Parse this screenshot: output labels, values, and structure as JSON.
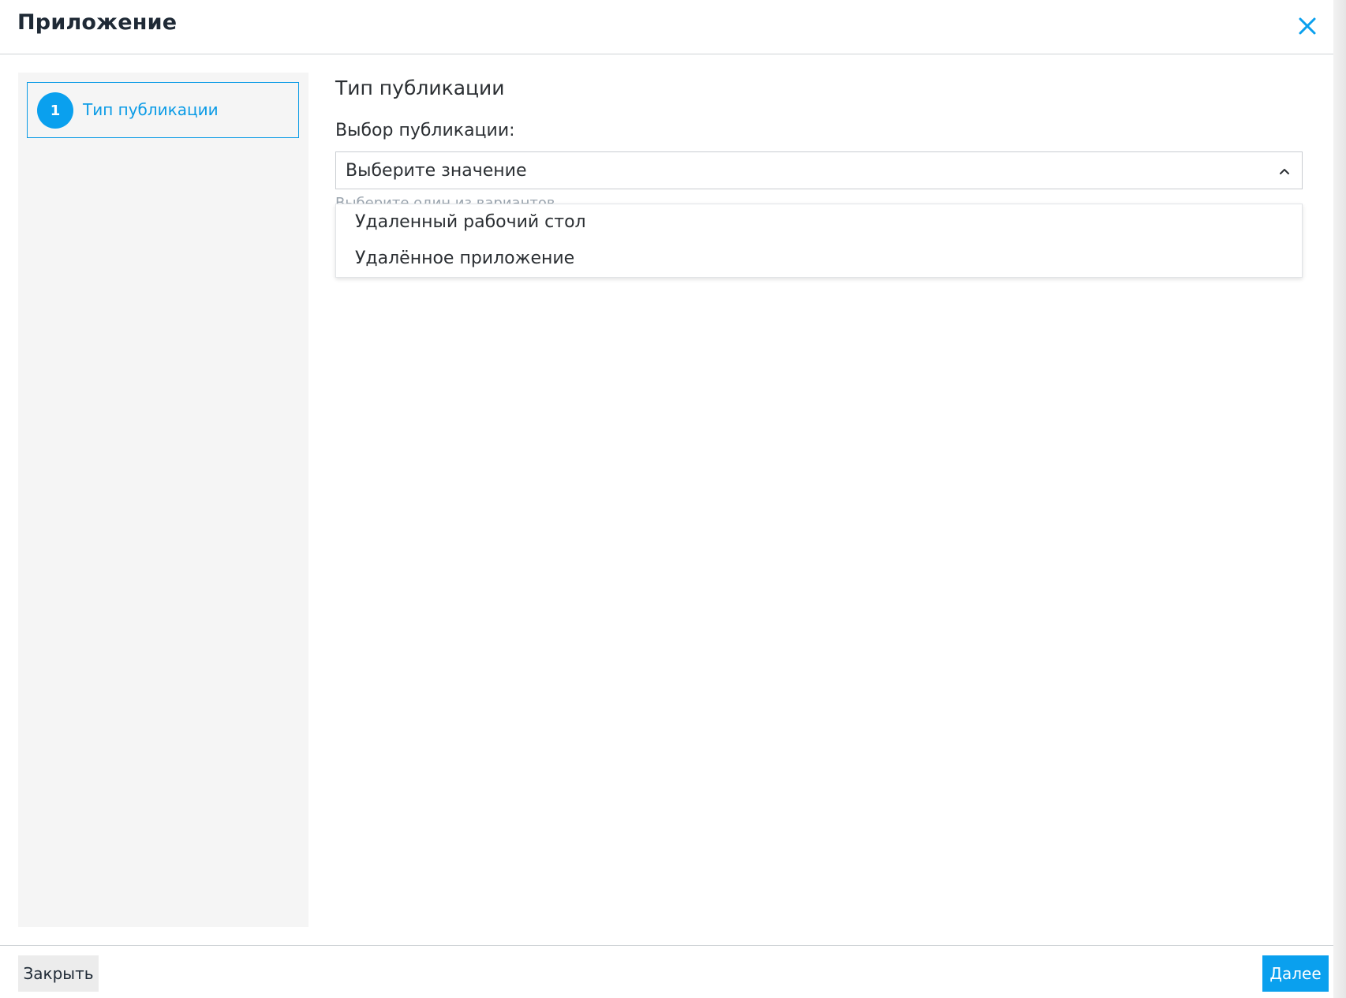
{
  "dialog": {
    "title": "Приложение",
    "close_icon": "close-icon"
  },
  "sidebar": {
    "steps": [
      {
        "number": "1",
        "label": "Тип публикации",
        "active": true
      }
    ]
  },
  "main": {
    "section_title": "Тип публикации",
    "field_label": "Выбор публикации:",
    "select": {
      "value": "Выберите значение",
      "expanded": true,
      "hint": "Выберите один из вариантов",
      "options": [
        "Удаленный рабочий стол",
        "Удалённое приложение"
      ]
    }
  },
  "footer": {
    "close_label": "Закрыть",
    "next_label": "Далее"
  },
  "colors": {
    "accent": "#0aa0ee",
    "title": "#1f2a36",
    "sidebar_bg": "#f5f5f5"
  }
}
